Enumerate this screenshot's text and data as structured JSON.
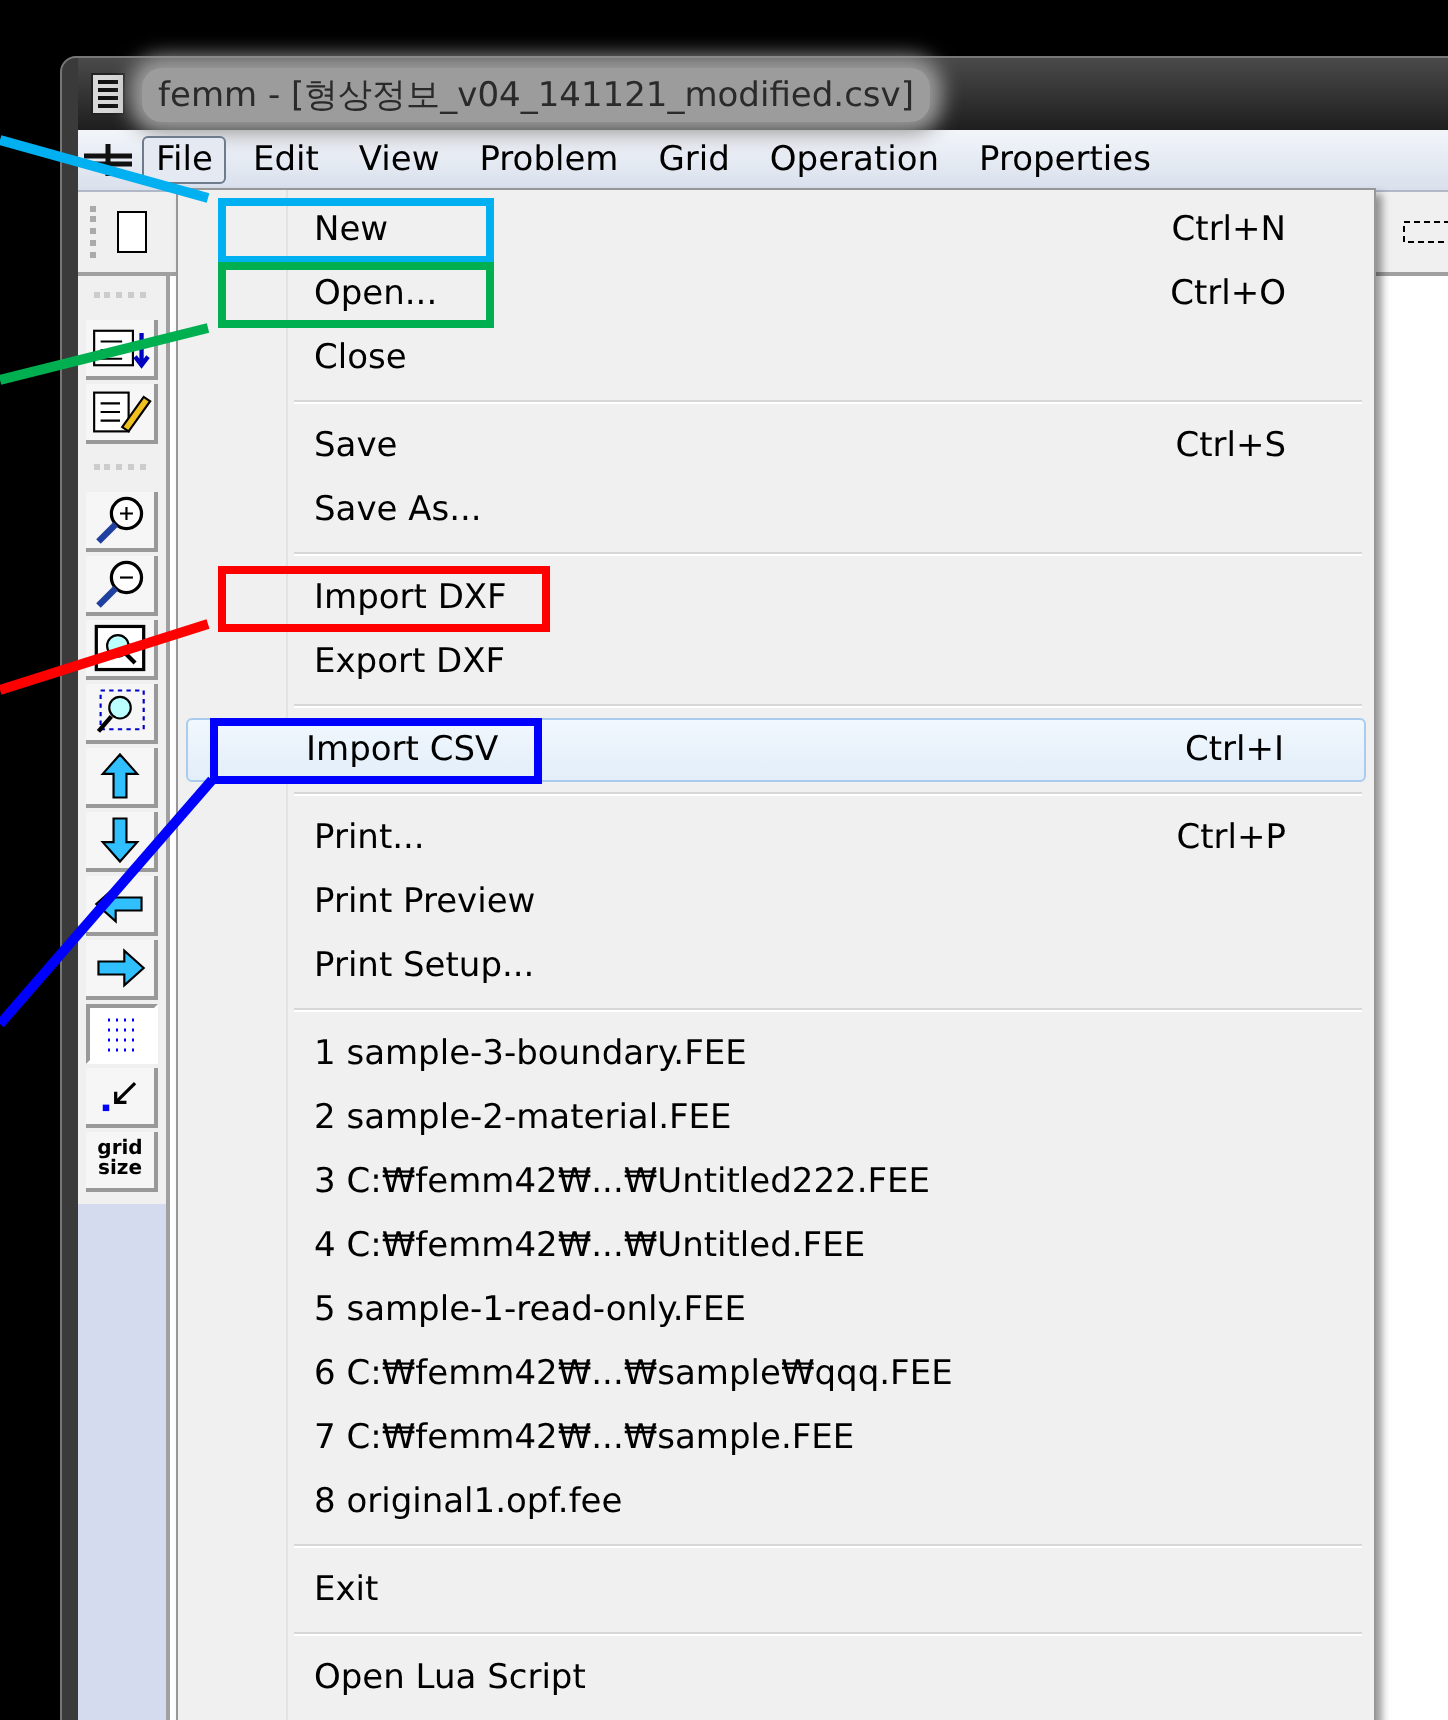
{
  "window": {
    "title": "femm - [형상정보_v04_141121_modified.csv]"
  },
  "menubar": [
    {
      "label": "File",
      "selected": true
    },
    {
      "label": "Edit",
      "selected": false
    },
    {
      "label": "View",
      "selected": false
    },
    {
      "label": "Problem",
      "selected": false
    },
    {
      "label": "Grid",
      "selected": false
    },
    {
      "label": "Operation",
      "selected": false
    },
    {
      "label": "Properties",
      "selected": false
    }
  ],
  "toolbar": {
    "grid_button": "grid size"
  },
  "file_menu": [
    {
      "kind": "item",
      "label": "New",
      "shortcut": "Ctrl+N",
      "selected": false,
      "color": "#00b0f0"
    },
    {
      "kind": "item",
      "label": "Open...",
      "shortcut": "Ctrl+O",
      "selected": false,
      "color": "#00b050"
    },
    {
      "kind": "item",
      "label": "Close",
      "selected": false
    },
    {
      "kind": "separator"
    },
    {
      "kind": "item",
      "label": "Save",
      "shortcut": "Ctrl+S",
      "selected": false
    },
    {
      "kind": "item",
      "label": "Save As...",
      "selected": false
    },
    {
      "kind": "separator"
    },
    {
      "kind": "item",
      "label": "Import DXF",
      "selected": false,
      "color": "#ff0000"
    },
    {
      "kind": "item",
      "label": "Export DXF",
      "selected": false
    },
    {
      "kind": "separator"
    },
    {
      "kind": "item",
      "label": "Import CSV",
      "shortcut": "Ctrl+I",
      "selected": true,
      "color": "#0000ff"
    },
    {
      "kind": "separator"
    },
    {
      "kind": "item",
      "label": "Print...",
      "shortcut": "Ctrl+P",
      "selected": false
    },
    {
      "kind": "item",
      "label": "Print Preview",
      "selected": false
    },
    {
      "kind": "item",
      "label": "Print Setup...",
      "selected": false
    },
    {
      "kind": "separator"
    },
    {
      "kind": "item",
      "label": "1 sample-3-boundary.FEE",
      "selected": false
    },
    {
      "kind": "item",
      "label": "2 sample-2-material.FEE",
      "selected": false
    },
    {
      "kind": "item",
      "label": "3 C:₩femm42₩...₩Untitled222.FEE",
      "selected": false
    },
    {
      "kind": "item",
      "label": "4 C:₩femm42₩...₩Untitled.FEE",
      "selected": false
    },
    {
      "kind": "item",
      "label": "5 sample-1-read-only.FEE",
      "selected": false
    },
    {
      "kind": "item",
      "label": "6 C:₩femm42₩...₩sample₩qqq.FEE",
      "selected": false
    },
    {
      "kind": "item",
      "label": "7 C:₩femm42₩...₩sample.FEE",
      "selected": false
    },
    {
      "kind": "item",
      "label": "8 original1.opf.fee",
      "selected": false
    },
    {
      "kind": "separator"
    },
    {
      "kind": "item",
      "label": "Exit",
      "selected": false
    },
    {
      "kind": "separator"
    },
    {
      "kind": "item",
      "label": "Open Lua Script",
      "selected": false
    }
  ]
}
